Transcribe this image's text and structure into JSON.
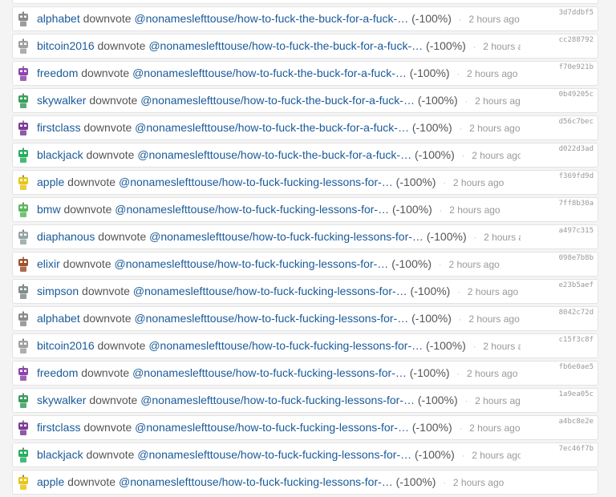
{
  "feed": [
    {
      "user": "alphabet",
      "action": "downvote",
      "link": "@nonameslefttouse/how-to-fuck-the-buck-for-a-fuck-…",
      "weight": "(-100%)",
      "time": "2 hours ago",
      "hash": "3d7ddbf5",
      "avatar_color": "#8c8c8c"
    },
    {
      "user": "alphabet",
      "action": "downvote",
      "link": "@nonameslefttouse/how-to-fuck-the-buck-for-a-fuck-…",
      "weight": "(-100%)",
      "time": "2 hours ago",
      "hash": "3d7ddbf5",
      "avatar_color": "#8c8c8c"
    },
    {
      "user": "bitcoin2016",
      "action": "downvote",
      "link": "@nonameslefttouse/how-to-fuck-the-buck-for-a-fuck-…",
      "weight": "(-100%)",
      "time": "2 hours ago",
      "hash": "cc288792",
      "avatar_color": "#a0a0a0"
    },
    {
      "user": "freedom",
      "action": "downvote",
      "link": "@nonameslefttouse/how-to-fuck-the-buck-for-a-fuck-…",
      "weight": "(-100%)",
      "time": "2 hours ago",
      "hash": "f70e921b",
      "avatar_color": "#8e44ad"
    },
    {
      "user": "skywalker",
      "action": "downvote",
      "link": "@nonameslefttouse/how-to-fuck-the-buck-for-a-fuck-…",
      "weight": "(-100%)",
      "time": "2 hours ago",
      "hash": "0b49205c",
      "avatar_color": "#3a9d5d"
    },
    {
      "user": "firstclass",
      "action": "downvote",
      "link": "@nonameslefttouse/how-to-fuck-the-buck-for-a-fuck-…",
      "weight": "(-100%)",
      "time": "2 hours ago",
      "hash": "d56c7bec",
      "avatar_color": "#7d3c98"
    },
    {
      "user": "blackjack",
      "action": "downvote",
      "link": "@nonameslefttouse/how-to-fuck-the-buck-for-a-fuck-…",
      "weight": "(-100%)",
      "time": "2 hours ago",
      "hash": "d022d3ad",
      "avatar_color": "#27ae60"
    },
    {
      "user": "apple",
      "action": "downvote",
      "link": "@nonameslefttouse/how-to-fuck-fucking-lessons-for-…",
      "weight": "(-100%)",
      "time": "2 hours ago",
      "hash": "f369fd9d",
      "avatar_color": "#e6c619"
    },
    {
      "user": "bmw",
      "action": "downvote",
      "link": "@nonameslefttouse/how-to-fuck-fucking-lessons-for-…",
      "weight": "(-100%)",
      "time": "2 hours ago",
      "hash": "7ff8b30a",
      "avatar_color": "#5cb85c"
    },
    {
      "user": "diaphanous",
      "action": "downvote",
      "link": "@nonameslefttouse/how-to-fuck-fucking-lessons-for-…",
      "weight": "(-100%)",
      "time": "2 hours ago",
      "hash": "a497c315",
      "avatar_color": "#95a5a6"
    },
    {
      "user": "elixir",
      "action": "downvote",
      "link": "@nonameslefttouse/how-to-fuck-fucking-lessons-for-…",
      "weight": "(-100%)",
      "time": "2 hours ago",
      "hash": "098e7b8b",
      "avatar_color": "#a0522d"
    },
    {
      "user": "simpson",
      "action": "downvote",
      "link": "@nonameslefttouse/how-to-fuck-fucking-lessons-for-…",
      "weight": "(-100%)",
      "time": "2 hours ago",
      "hash": "e23b5aef",
      "avatar_color": "#7f8c8d"
    },
    {
      "user": "alphabet",
      "action": "downvote",
      "link": "@nonameslefttouse/how-to-fuck-fucking-lessons-for-…",
      "weight": "(-100%)",
      "time": "2 hours ago",
      "hash": "8042c72d",
      "avatar_color": "#8c8c8c"
    },
    {
      "user": "bitcoin2016",
      "action": "downvote",
      "link": "@nonameslefttouse/how-to-fuck-fucking-lessons-for-…",
      "weight": "(-100%)",
      "time": "2 hours ago",
      "hash": "c15f3c8f",
      "avatar_color": "#a0a0a0"
    },
    {
      "user": "freedom",
      "action": "downvote",
      "link": "@nonameslefttouse/how-to-fuck-fucking-lessons-for-…",
      "weight": "(-100%)",
      "time": "2 hours ago",
      "hash": "fb6e0ae5",
      "avatar_color": "#8e44ad"
    },
    {
      "user": "skywalker",
      "action": "downvote",
      "link": "@nonameslefttouse/how-to-fuck-fucking-lessons-for-…",
      "weight": "(-100%)",
      "time": "2 hours ago",
      "hash": "1a9ea05c",
      "avatar_color": "#3a9d5d"
    },
    {
      "user": "firstclass",
      "action": "downvote",
      "link": "@nonameslefttouse/how-to-fuck-fucking-lessons-for-…",
      "weight": "(-100%)",
      "time": "2 hours ago",
      "hash": "a4bc8e2e",
      "avatar_color": "#7d3c98"
    },
    {
      "user": "blackjack",
      "action": "downvote",
      "link": "@nonameslefttouse/how-to-fuck-fucking-lessons-for-…",
      "weight": "(-100%)",
      "time": "2 hours ago",
      "hash": "7ec46f7b",
      "avatar_color": "#27ae60"
    },
    {
      "user": "apple",
      "action": "downvote",
      "link": "@nonameslefttouse/how-to-fuck-fucking-lessons-for-…",
      "weight": "(-100%)",
      "time": "2 hours ago",
      "hash": "",
      "avatar_color": "#e6c619"
    }
  ]
}
